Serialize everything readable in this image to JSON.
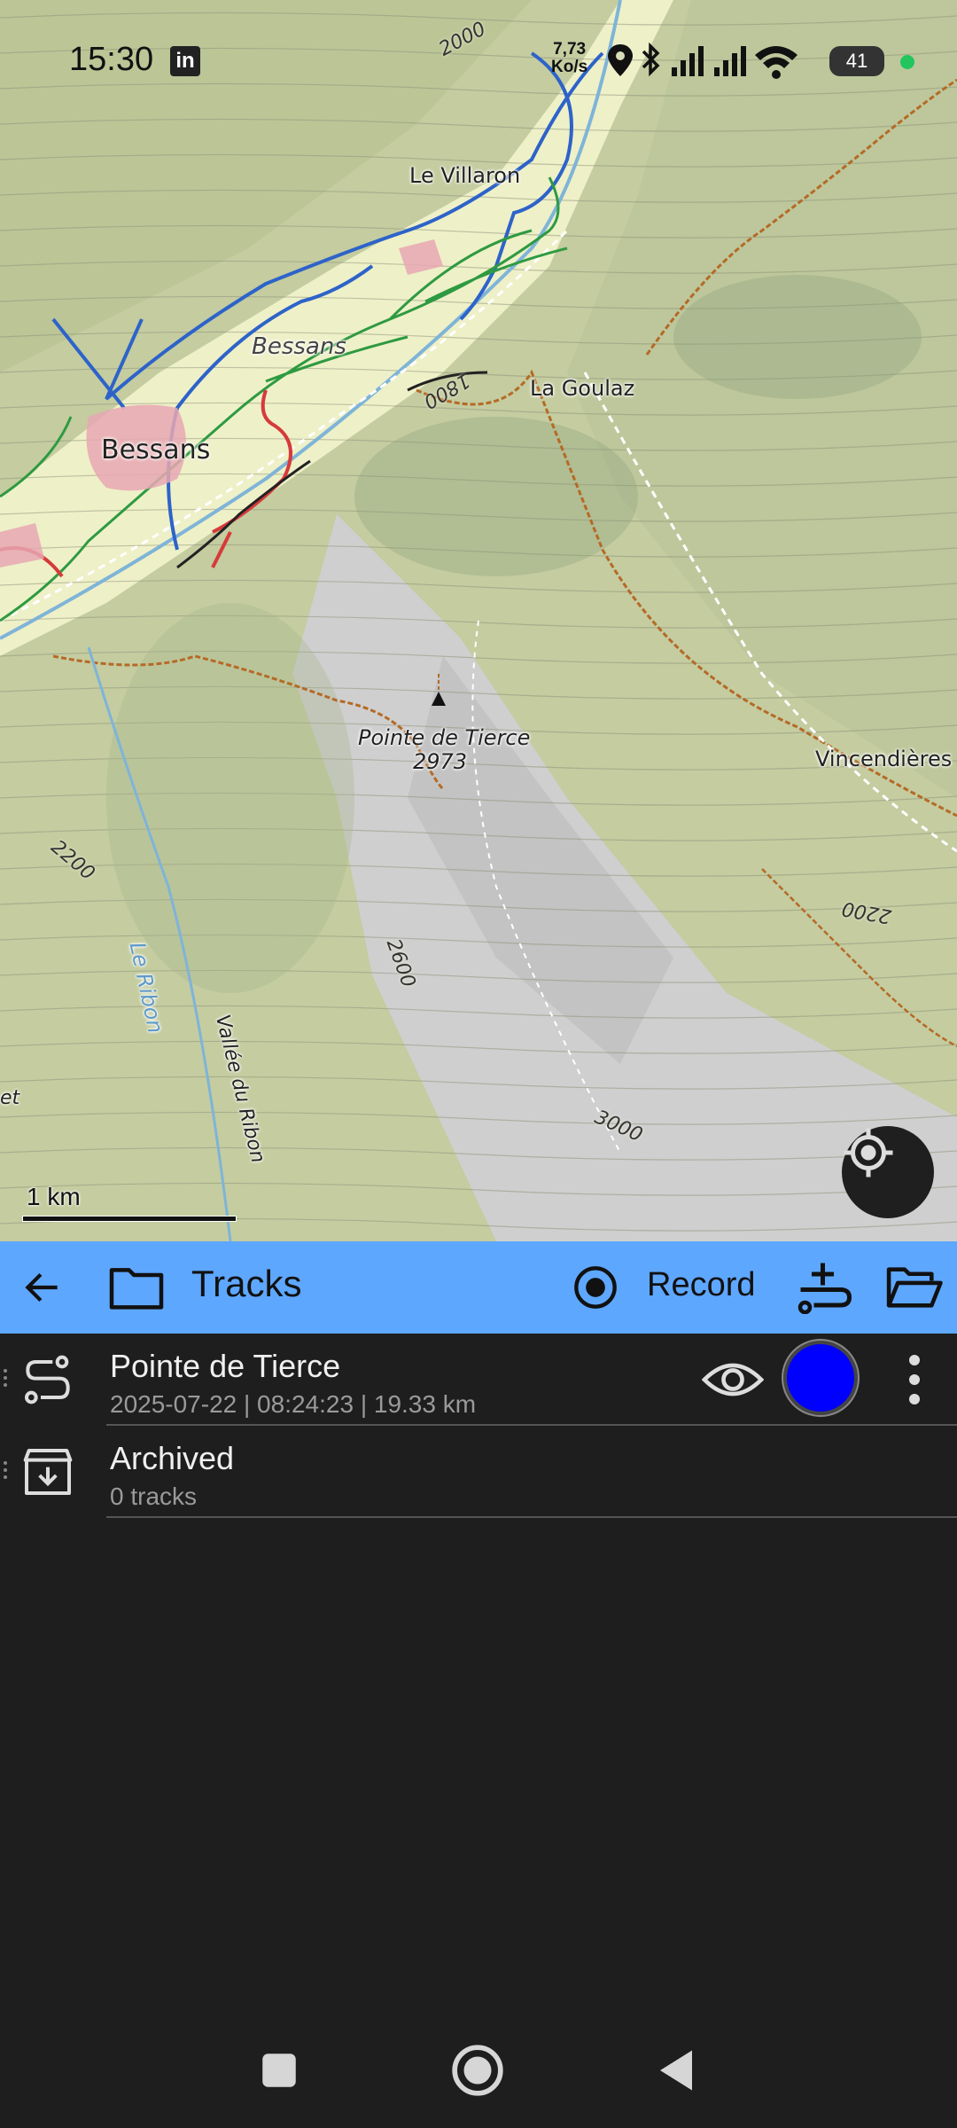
{
  "status_bar": {
    "time": "15:30",
    "speed_value": "7,73",
    "speed_unit": "Ko/s",
    "battery": "41"
  },
  "map": {
    "places": {
      "le_villaron": "Le Villaron",
      "bessans_italic": "Bessans",
      "bessans": "Bessans",
      "la_goulaz": "La Goulaz",
      "pointe_name": "Pointe de Tierce",
      "pointe_elevation": "2973",
      "vincendieres": "Vincendières",
      "le_ribon": "Le Ribon",
      "vallee_du_ribon": "Vallée du Ribon",
      "et": "et"
    },
    "contours": {
      "c2000": "2000",
      "c1800": "1800",
      "c2200_left": "2200",
      "c2600": "2600",
      "c2200_right": "2200",
      "c3000": "3000"
    },
    "scale_label": "1 km"
  },
  "toolbar": {
    "title": "Tracks",
    "record_label": "Record"
  },
  "list": {
    "items": [
      {
        "title": "Pointe de Tierce",
        "subtitle": "2025-07-22 | 08:24:23 | 19.33 km",
        "color": "#0000ff"
      },
      {
        "title": "Archived",
        "subtitle": "0 tracks"
      }
    ]
  },
  "colors": {
    "toolbar_bg": "#5ea7ff",
    "panel_bg": "#1e1e1e",
    "track_color": "#0000ff"
  },
  "icons": [
    "linkedin-icon",
    "location-pin-icon",
    "bluetooth-icon",
    "signal-icon",
    "wifi-icon",
    "back-arrow-icon",
    "folder-icon",
    "record-icon",
    "add-track-icon",
    "open-folder-icon",
    "route-icon",
    "eye-icon",
    "more-vert-icon",
    "archive-icon",
    "locate-icon",
    "home-icon",
    "recents-icon",
    "nav-back-icon"
  ]
}
